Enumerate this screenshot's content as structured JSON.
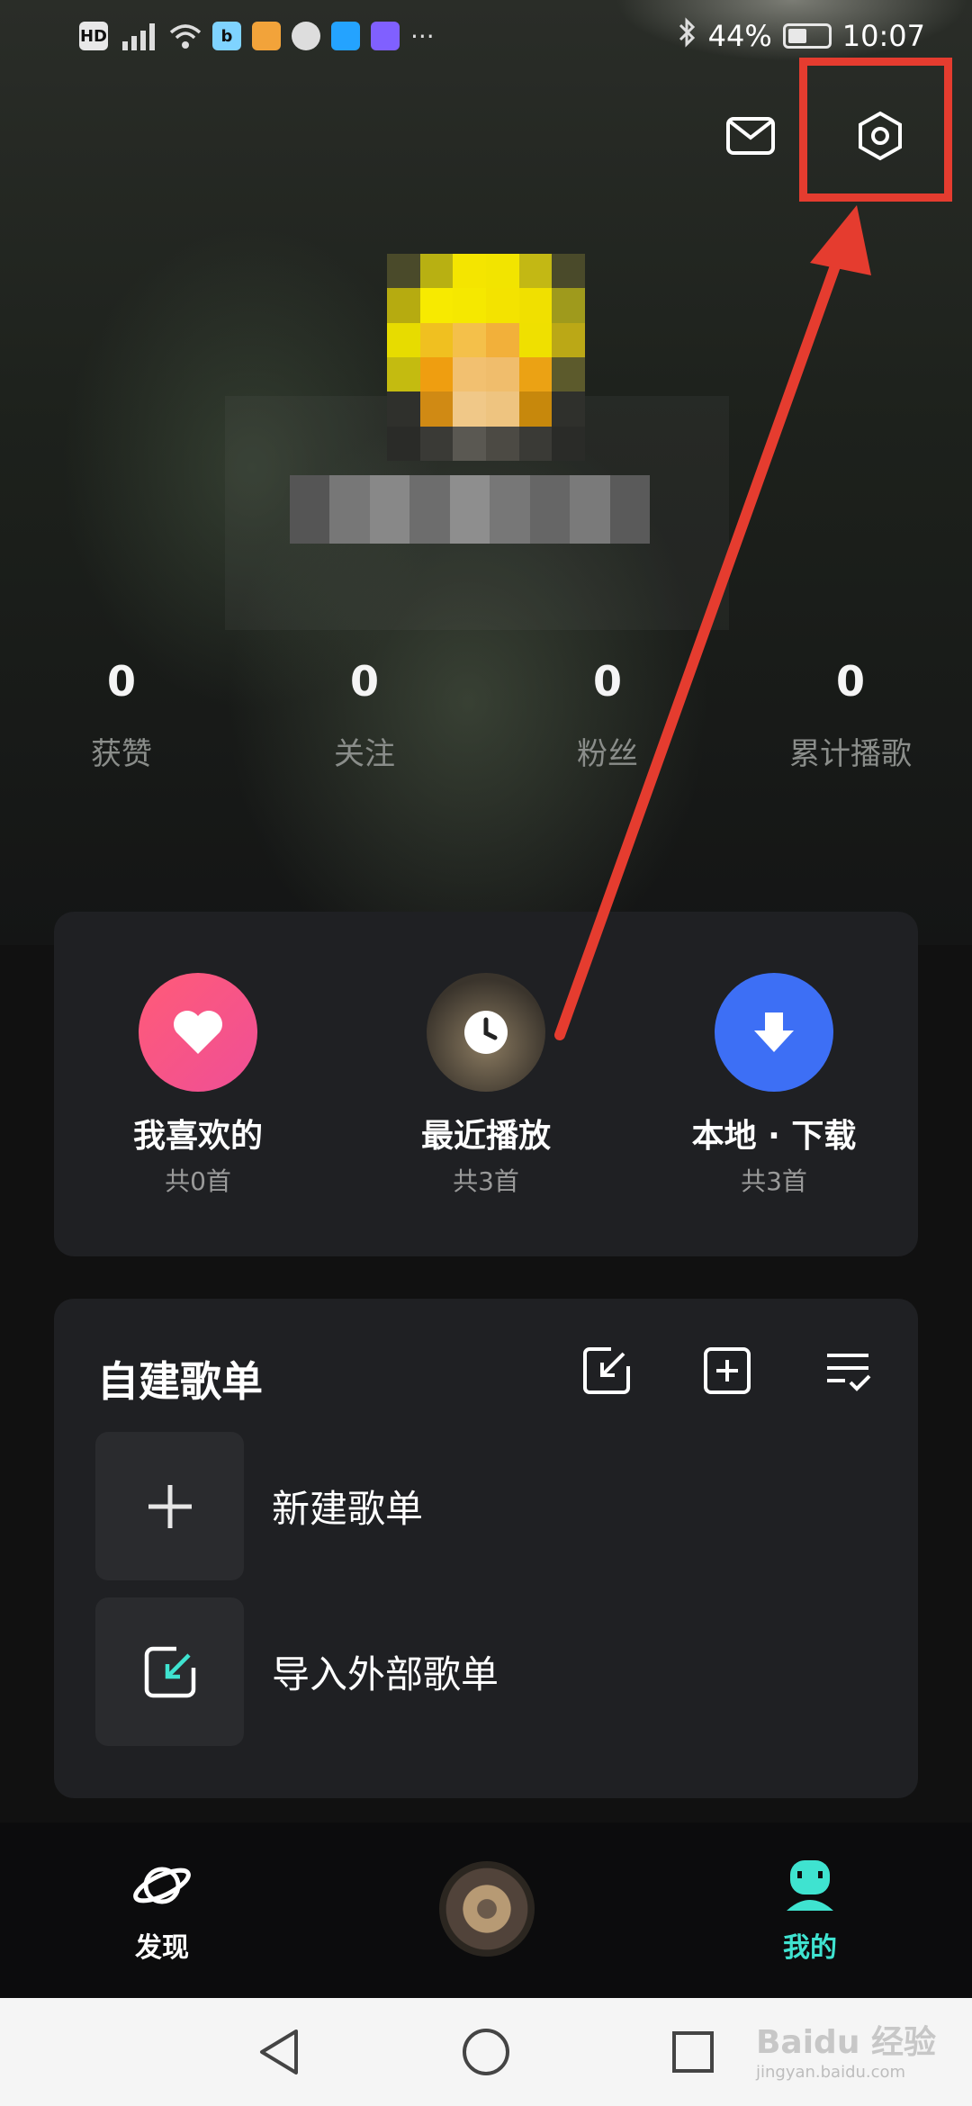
{
  "status_bar": {
    "left_icons": [
      "HD",
      "4G",
      "signal",
      "wifi",
      "b",
      "app",
      "chrome",
      "search",
      "music",
      "..."
    ],
    "bluetooth": "bluetooth-icon",
    "battery": "44%",
    "battery_level": 0.44,
    "time": "10:07"
  },
  "header": {
    "mail_icon": "mail-icon",
    "settings_icon": "settings-icon"
  },
  "stats": [
    {
      "value": "0",
      "label": "获赞"
    },
    {
      "value": "0",
      "label": "关注"
    },
    {
      "value": "0",
      "label": "粉丝"
    },
    {
      "value": "0",
      "label": "累计播歌"
    }
  ],
  "quick_access": [
    {
      "title": "我喜欢的",
      "subtitle": "共0首",
      "icon": "heart-icon",
      "color": "#f7537b"
    },
    {
      "title": "最近播放",
      "subtitle": "共3首",
      "icon": "clock-icon",
      "color": "#3c3a36"
    },
    {
      "title": "本地 · 下载",
      "subtitle": "共3首",
      "icon": "download-icon",
      "color": "#3d6ff5"
    }
  ],
  "playlists": {
    "title": "自建歌单",
    "actions": [
      "import-icon",
      "add-icon",
      "manage-list-icon"
    ],
    "items": [
      {
        "label": "新建歌单",
        "icon": "plus-icon"
      },
      {
        "label": "导入外部歌单",
        "icon": "import-icon"
      }
    ]
  },
  "tabbar": {
    "tabs": [
      {
        "label": "发现",
        "icon": "planet-icon",
        "active": false
      },
      {
        "label": "我的",
        "icon": "profile-icon",
        "active": true
      }
    ],
    "active_color": "#3fe3d0"
  },
  "watermark": {
    "text": "Baidu 经验",
    "sub": "jingyan.baidu.com"
  },
  "annotation_color": "#e53c2f"
}
